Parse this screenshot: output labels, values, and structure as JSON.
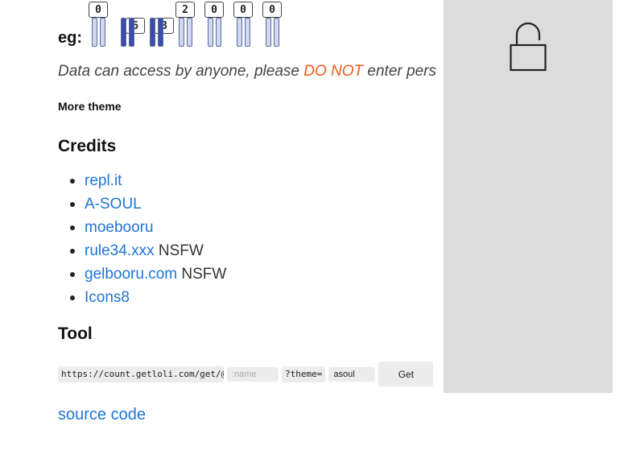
{
  "eg": {
    "label": "eg:",
    "counter_digits": [
      "0",
      "6",
      "3",
      "2",
      "0",
      "0",
      "0"
    ]
  },
  "notice": {
    "prefix": "Data can access by anyone, please ",
    "warning": "DO NOT",
    "suffix": " enter pers"
  },
  "more_theme": "More theme",
  "credits": {
    "heading": "Credits",
    "items": [
      {
        "link": "repl.it",
        "tag": ""
      },
      {
        "link": "A-SOUL",
        "tag": ""
      },
      {
        "link": "moebooru",
        "tag": ""
      },
      {
        "link": "rule34.xxx",
        "tag": "NSFW"
      },
      {
        "link": "gelbooru.com",
        "tag": "NSFW"
      },
      {
        "link": "Icons8",
        "tag": ""
      }
    ]
  },
  "tool": {
    "heading": "Tool",
    "url_prefix": "https://count.getloli.com/get/@",
    "name_placeholder": ":name",
    "theme_prefix": "?theme=",
    "theme_value": "asoul",
    "get_label": "Get"
  },
  "source_code": "source code",
  "icons": {
    "overlay": "lock-open-icon"
  },
  "colors": {
    "link": "#1e74d6",
    "warning": "#f25a1c",
    "overlay_bg": "#dcdcdc"
  }
}
